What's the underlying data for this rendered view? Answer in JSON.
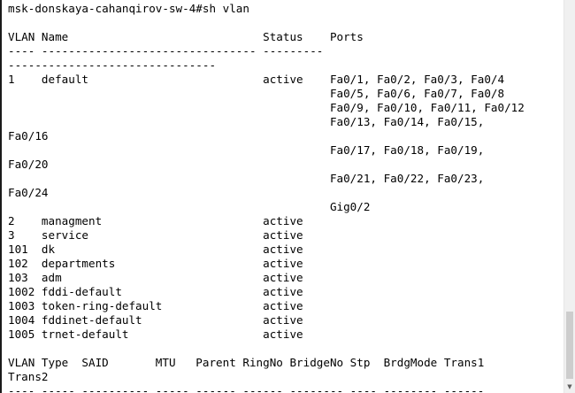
{
  "terminal": {
    "lines": [
      "msk-donskaya-cahanqirov-sw-4#sh vlan",
      "",
      "VLAN Name                             Status    Ports",
      "---- -------------------------------- --------- ",
      "-------------------------------",
      "1    default                          active    Fa0/1, Fa0/2, Fa0/3, Fa0/4",
      "                                                Fa0/5, Fa0/6, Fa0/7, Fa0/8",
      "                                                Fa0/9, Fa0/10, Fa0/11, Fa0/12",
      "                                                Fa0/13, Fa0/14, Fa0/15,",
      "Fa0/16",
      "                                                Fa0/17, Fa0/18, Fa0/19,",
      "Fa0/20",
      "                                                Fa0/21, Fa0/22, Fa0/23,",
      "Fa0/24",
      "                                                Gig0/2",
      "2    managment                        active    ",
      "3    service                          active    ",
      "101  dk                               active    ",
      "102  departments                      active    ",
      "103  adm                              active    ",
      "1002 fddi-default                     active    ",
      "1003 token-ring-default               active    ",
      "1004 fddinet-default                  active    ",
      "1005 trnet-default                    active    ",
      "",
      "VLAN Type  SAID       MTU   Parent RingNo BridgeNo Stp  BrdgMode Trans1",
      "Trans2",
      "---- ----- ---------- ----- ------ ------ -------- ---- -------- ------"
    ]
  },
  "scrollbar": {
    "down_icon": "▼",
    "scroll_position": 0.95
  }
}
